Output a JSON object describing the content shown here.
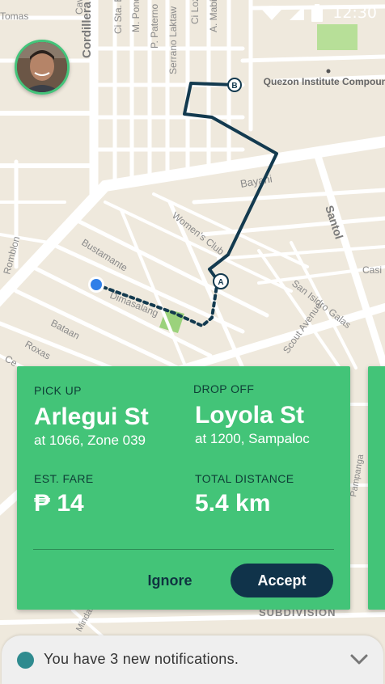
{
  "status_bar": {
    "time": "12:30"
  },
  "map": {
    "streets": [
      "Cordillera",
      "Bayani",
      "Santol",
      "Women's Club",
      "Bustamante",
      "Dimasalang",
      "Bataan",
      "Roxas",
      "San Isidro Galas",
      "Romblon",
      "Serrano Laktaw",
      "P. Paterno",
      "M. Ponce",
      "Ci Sta. Elena",
      "Ci Lozano",
      "A. Mabini",
      "Cavite",
      "Tomas",
      "Ce",
      "Scout Avenue",
      "Pampanga",
      "Casi",
      "Mindanao"
    ],
    "landmark": "Quezon Institute Compound",
    "marker_a": "A",
    "marker_b": "B",
    "subdivision": "SUBDIVISION"
  },
  "ride": {
    "pickup_label": "PICK UP",
    "pickup_street": "Arlegui St",
    "pickup_detail": "at 1066, Zone 039",
    "dropoff_label": "DROP OFF",
    "dropoff_street": "Loyola St",
    "dropoff_detail": "at 1200, Sampaloc",
    "fare_label": "EST. FARE",
    "fare_value": "₱ 14",
    "distance_label": "TOTAL DISTANCE",
    "distance_value": "5.4 km",
    "ignore_label": "Ignore",
    "accept_label": "Accept"
  },
  "notification": {
    "text": "You have 3 new notifications."
  },
  "colors": {
    "card": "#43c478",
    "accept": "#10334a",
    "route": "#133a4f",
    "map_bg": "#efe9dd",
    "road": "#ffffff",
    "park": "#b7df98"
  },
  "icons": {
    "wifi": "wifi-icon",
    "signal": "signal-icon",
    "battery": "battery-icon",
    "chevron": "chevron-down-icon",
    "current_location": "current-location-icon"
  }
}
